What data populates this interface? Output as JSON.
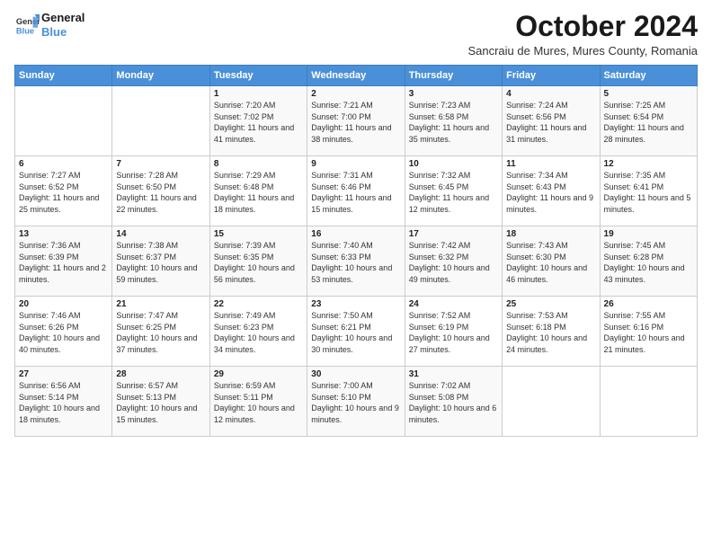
{
  "logo": {
    "line1": "General",
    "line2": "Blue"
  },
  "title": "October 2024",
  "subtitle": "Sancraiu de Mures, Mures County, Romania",
  "header_days": [
    "Sunday",
    "Monday",
    "Tuesday",
    "Wednesday",
    "Thursday",
    "Friday",
    "Saturday"
  ],
  "weeks": [
    [
      {
        "day": "",
        "sunrise": "",
        "sunset": "",
        "daylight": ""
      },
      {
        "day": "",
        "sunrise": "",
        "sunset": "",
        "daylight": ""
      },
      {
        "day": "1",
        "sunrise": "Sunrise: 7:20 AM",
        "sunset": "Sunset: 7:02 PM",
        "daylight": "Daylight: 11 hours and 41 minutes."
      },
      {
        "day": "2",
        "sunrise": "Sunrise: 7:21 AM",
        "sunset": "Sunset: 7:00 PM",
        "daylight": "Daylight: 11 hours and 38 minutes."
      },
      {
        "day": "3",
        "sunrise": "Sunrise: 7:23 AM",
        "sunset": "Sunset: 6:58 PM",
        "daylight": "Daylight: 11 hours and 35 minutes."
      },
      {
        "day": "4",
        "sunrise": "Sunrise: 7:24 AM",
        "sunset": "Sunset: 6:56 PM",
        "daylight": "Daylight: 11 hours and 31 minutes."
      },
      {
        "day": "5",
        "sunrise": "Sunrise: 7:25 AM",
        "sunset": "Sunset: 6:54 PM",
        "daylight": "Daylight: 11 hours and 28 minutes."
      }
    ],
    [
      {
        "day": "6",
        "sunrise": "Sunrise: 7:27 AM",
        "sunset": "Sunset: 6:52 PM",
        "daylight": "Daylight: 11 hours and 25 minutes."
      },
      {
        "day": "7",
        "sunrise": "Sunrise: 7:28 AM",
        "sunset": "Sunset: 6:50 PM",
        "daylight": "Daylight: 11 hours and 22 minutes."
      },
      {
        "day": "8",
        "sunrise": "Sunrise: 7:29 AM",
        "sunset": "Sunset: 6:48 PM",
        "daylight": "Daylight: 11 hours and 18 minutes."
      },
      {
        "day": "9",
        "sunrise": "Sunrise: 7:31 AM",
        "sunset": "Sunset: 6:46 PM",
        "daylight": "Daylight: 11 hours and 15 minutes."
      },
      {
        "day": "10",
        "sunrise": "Sunrise: 7:32 AM",
        "sunset": "Sunset: 6:45 PM",
        "daylight": "Daylight: 11 hours and 12 minutes."
      },
      {
        "day": "11",
        "sunrise": "Sunrise: 7:34 AM",
        "sunset": "Sunset: 6:43 PM",
        "daylight": "Daylight: 11 hours and 9 minutes."
      },
      {
        "day": "12",
        "sunrise": "Sunrise: 7:35 AM",
        "sunset": "Sunset: 6:41 PM",
        "daylight": "Daylight: 11 hours and 5 minutes."
      }
    ],
    [
      {
        "day": "13",
        "sunrise": "Sunrise: 7:36 AM",
        "sunset": "Sunset: 6:39 PM",
        "daylight": "Daylight: 11 hours and 2 minutes."
      },
      {
        "day": "14",
        "sunrise": "Sunrise: 7:38 AM",
        "sunset": "Sunset: 6:37 PM",
        "daylight": "Daylight: 10 hours and 59 minutes."
      },
      {
        "day": "15",
        "sunrise": "Sunrise: 7:39 AM",
        "sunset": "Sunset: 6:35 PM",
        "daylight": "Daylight: 10 hours and 56 minutes."
      },
      {
        "day": "16",
        "sunrise": "Sunrise: 7:40 AM",
        "sunset": "Sunset: 6:33 PM",
        "daylight": "Daylight: 10 hours and 53 minutes."
      },
      {
        "day": "17",
        "sunrise": "Sunrise: 7:42 AM",
        "sunset": "Sunset: 6:32 PM",
        "daylight": "Daylight: 10 hours and 49 minutes."
      },
      {
        "day": "18",
        "sunrise": "Sunrise: 7:43 AM",
        "sunset": "Sunset: 6:30 PM",
        "daylight": "Daylight: 10 hours and 46 minutes."
      },
      {
        "day": "19",
        "sunrise": "Sunrise: 7:45 AM",
        "sunset": "Sunset: 6:28 PM",
        "daylight": "Daylight: 10 hours and 43 minutes."
      }
    ],
    [
      {
        "day": "20",
        "sunrise": "Sunrise: 7:46 AM",
        "sunset": "Sunset: 6:26 PM",
        "daylight": "Daylight: 10 hours and 40 minutes."
      },
      {
        "day": "21",
        "sunrise": "Sunrise: 7:47 AM",
        "sunset": "Sunset: 6:25 PM",
        "daylight": "Daylight: 10 hours and 37 minutes."
      },
      {
        "day": "22",
        "sunrise": "Sunrise: 7:49 AM",
        "sunset": "Sunset: 6:23 PM",
        "daylight": "Daylight: 10 hours and 34 minutes."
      },
      {
        "day": "23",
        "sunrise": "Sunrise: 7:50 AM",
        "sunset": "Sunset: 6:21 PM",
        "daylight": "Daylight: 10 hours and 30 minutes."
      },
      {
        "day": "24",
        "sunrise": "Sunrise: 7:52 AM",
        "sunset": "Sunset: 6:19 PM",
        "daylight": "Daylight: 10 hours and 27 minutes."
      },
      {
        "day": "25",
        "sunrise": "Sunrise: 7:53 AM",
        "sunset": "Sunset: 6:18 PM",
        "daylight": "Daylight: 10 hours and 24 minutes."
      },
      {
        "day": "26",
        "sunrise": "Sunrise: 7:55 AM",
        "sunset": "Sunset: 6:16 PM",
        "daylight": "Daylight: 10 hours and 21 minutes."
      }
    ],
    [
      {
        "day": "27",
        "sunrise": "Sunrise: 6:56 AM",
        "sunset": "Sunset: 5:14 PM",
        "daylight": "Daylight: 10 hours and 18 minutes."
      },
      {
        "day": "28",
        "sunrise": "Sunrise: 6:57 AM",
        "sunset": "Sunset: 5:13 PM",
        "daylight": "Daylight: 10 hours and 15 minutes."
      },
      {
        "day": "29",
        "sunrise": "Sunrise: 6:59 AM",
        "sunset": "Sunset: 5:11 PM",
        "daylight": "Daylight: 10 hours and 12 minutes."
      },
      {
        "day": "30",
        "sunrise": "Sunrise: 7:00 AM",
        "sunset": "Sunset: 5:10 PM",
        "daylight": "Daylight: 10 hours and 9 minutes."
      },
      {
        "day": "31",
        "sunrise": "Sunrise: 7:02 AM",
        "sunset": "Sunset: 5:08 PM",
        "daylight": "Daylight: 10 hours and 6 minutes."
      },
      {
        "day": "",
        "sunrise": "",
        "sunset": "",
        "daylight": ""
      },
      {
        "day": "",
        "sunrise": "",
        "sunset": "",
        "daylight": ""
      }
    ]
  ]
}
